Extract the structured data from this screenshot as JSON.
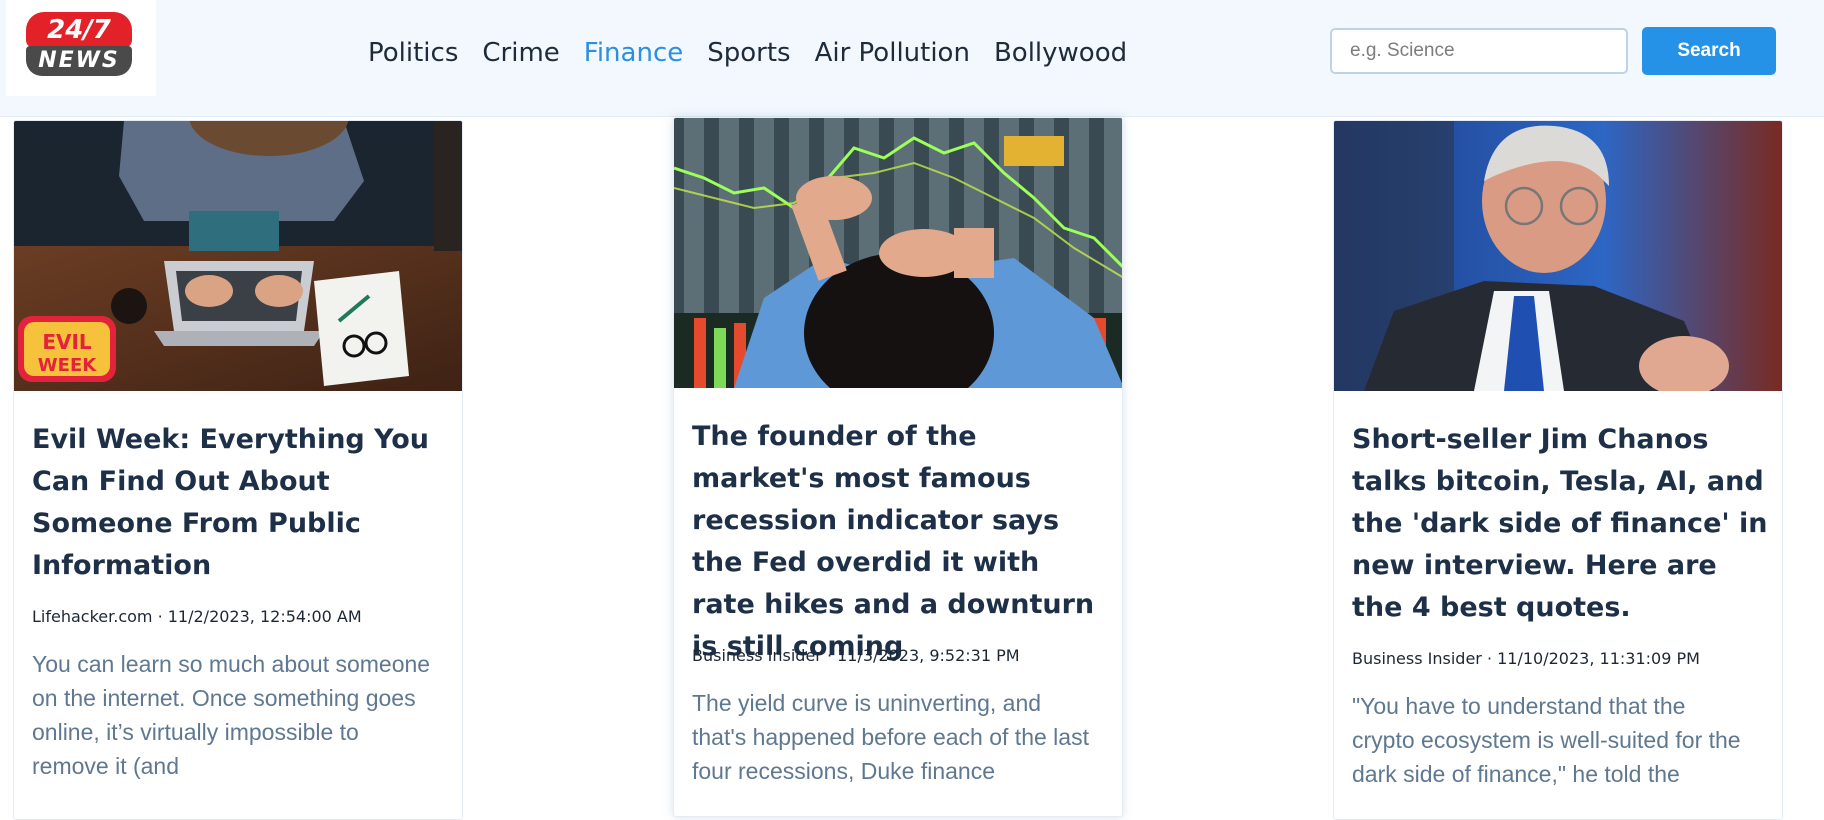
{
  "logo": {
    "top_text": "24/7",
    "bottom_text": "NEWS"
  },
  "nav": {
    "items": [
      "Politics",
      "Crime",
      "Finance",
      "Sports",
      "Air Pollution",
      "Bollywood"
    ],
    "active": "Finance"
  },
  "search": {
    "placeholder": "e.g. Science",
    "value": "",
    "button_label": "Search"
  },
  "colors": {
    "accent": "#2592e8",
    "title": "#1d3048",
    "description": "#5f7891",
    "logo_red": "#e32129"
  },
  "articles": [
    {
      "title": "Evil Week: Everything You Can Find Out About Someone From Public Information",
      "source": "Lifehacker.com",
      "date": "11/2/2023, 12:54:00 AM",
      "description": "You can learn so much about someone on the internet. Once something goes online, it’s virtually impossible to remove it (and",
      "badge": "EVIL WEEK",
      "image": "person-typing-laptop"
    },
    {
      "title": "The founder of the market's most famous recession indicator says the Fed overdid it with rate hikes and a downturn is still coming",
      "source": "Business Insider",
      "date": "11/3/2023, 9:52:31 PM",
      "description": "The yield curve is uninverting, and that's happened before each of the last four recessions, Duke finance",
      "image": "trader-stock-chart"
    },
    {
      "title": "Short-seller Jim Chanos talks bitcoin, Tesla, AI, and the 'dark side of finance' in new interview. Here are the 4 best quotes.",
      "source": "Business Insider",
      "date": "11/10/2023, 11:31:09 PM",
      "description": "\"You have to understand that the crypto ecosystem is well-suited for the dark side of finance,\" he told the",
      "image": "man-in-suit-interview"
    }
  ]
}
